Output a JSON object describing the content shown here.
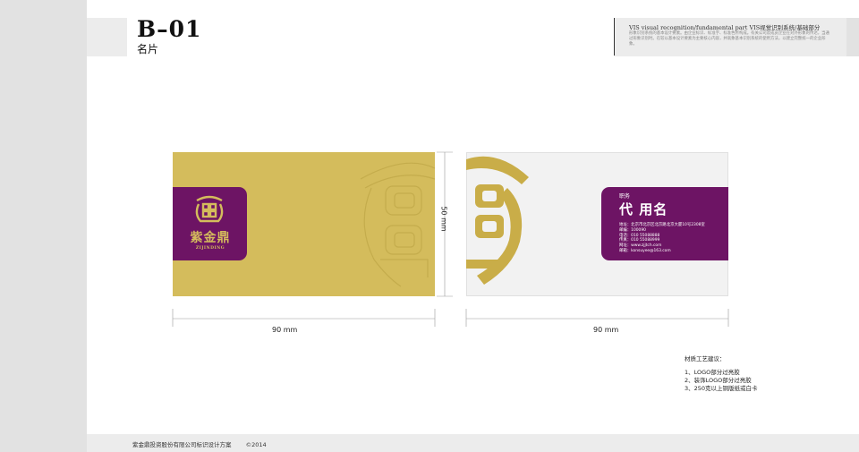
{
  "header": {
    "code": "B–01",
    "subtitle": "名片",
    "vis_title": "VIS visual recognition/fundamental part   VIS视觉识别系统/基础部分",
    "vis_description": "形象识别系统的基本设计要素。由企业标识、标准字、标准色所构成。有关公司及成员企业在对外形象的传达，当通过形象识别时。在较以基本设计要素为主要核心内容，并就象基本识别系统的使用方法，以建立完整统一的企业形象。"
  },
  "card_front": {
    "brand_cn": "紫金鼎",
    "brand_en": "ZIJINDING",
    "color": "#d4bc5c"
  },
  "card_back": {
    "role": "职务",
    "name": "代 用名",
    "lines": [
      "地址：北京市北京区北京路北京大厦10号2308室",
      "邮编：100090",
      "电话：010 55088888",
      "传真：010 55088999",
      "网址：www.zjjtch.com",
      "邮箱：konsuyee@163.com"
    ],
    "panel_color": "#6d1464"
  },
  "dimensions": {
    "height": "50  mm",
    "width_front": "90   mm",
    "width_back": "90   mm"
  },
  "materials": {
    "title": "材质工艺建议：",
    "items": [
      "1、LOGO部分过亮胶",
      "2、装饰LOGO部分过亮胶",
      "3、250克以上铜版纸或白卡"
    ]
  },
  "footer": {
    "company": "紫金鼎投资股份有限公司标识设计方案",
    "copyright": "©2014"
  }
}
